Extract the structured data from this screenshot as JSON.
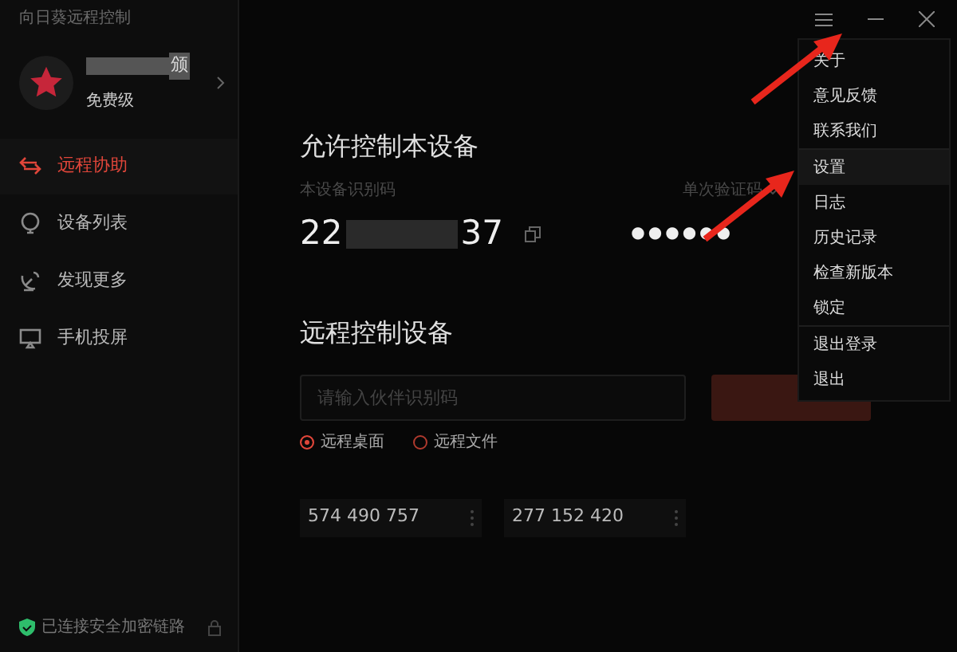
{
  "app_title": "向日葵远程控制",
  "user": {
    "name_tail": "颁",
    "tier": "免费级"
  },
  "nav": [
    {
      "label": "远程协助",
      "kind": "assist",
      "selected": true
    },
    {
      "label": "设备列表",
      "kind": "devices",
      "selected": false
    },
    {
      "label": "发现更多",
      "kind": "discover",
      "selected": false
    },
    {
      "label": "手机投屏",
      "kind": "cast",
      "selected": false
    }
  ],
  "status": "已连接安全加密链路",
  "allow": {
    "title": "允许控制本设备",
    "id_label": "本设备识别码",
    "id_start": "22",
    "id_end": "37",
    "code_label": "单次验证码",
    "code": "●●●●●●"
  },
  "remote": {
    "title": "远程控制设备",
    "placeholder": "请输入伙伴识别码",
    "options": [
      {
        "label": "远程桌面",
        "selected": true
      },
      {
        "label": "远程文件",
        "selected": false
      }
    ],
    "recent": [
      "574 490 757",
      "277 152 420"
    ]
  },
  "menu": {
    "groups": [
      [
        {
          "label": "关于",
          "selected": false
        },
        {
          "label": "意见反馈",
          "selected": false
        },
        {
          "label": "联系我们",
          "selected": false
        }
      ],
      [
        {
          "label": "设置",
          "selected": true
        },
        {
          "label": "日志",
          "selected": false
        },
        {
          "label": "历史记录",
          "selected": false
        },
        {
          "label": "检查新版本",
          "selected": false
        },
        {
          "label": "锁定",
          "selected": false
        }
      ],
      [
        {
          "label": "退出登录",
          "selected": false
        },
        {
          "label": "退出",
          "selected": false
        }
      ]
    ]
  }
}
